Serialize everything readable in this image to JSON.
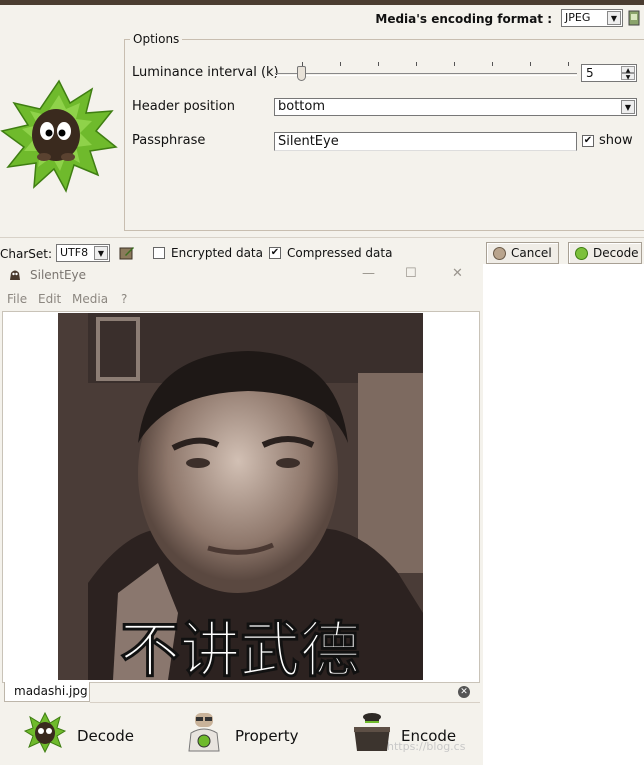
{
  "header": {
    "encoding_label": "Media's encoding format :",
    "encoding_value": "JPEG"
  },
  "options": {
    "title": "Options",
    "luminance_label": "Luminance interval (k)",
    "luminance_value": "5",
    "header_position_label": "Header position",
    "header_position_value": "bottom",
    "passphrase_label": "Passphrase",
    "passphrase_value": "SilentEye",
    "show_label": "show",
    "show_checked": true
  },
  "toolbar": {
    "charset_label": "CharSet:",
    "charset_value": "UTF8",
    "encrypted_label": "Encrypted data",
    "encrypted_checked": false,
    "compressed_label": "Compressed data",
    "compressed_checked": true,
    "cancel_label": "Cancel",
    "decode_label": "Decode"
  },
  "window": {
    "title": "SilentEye",
    "controls": [
      "—",
      "☐",
      "✕"
    ],
    "menu": [
      "File",
      "Edit",
      "Media",
      "?"
    ],
    "image_caption": "不讲武德",
    "tab_label": "madashi.jpg",
    "actions": [
      "Decode",
      "Property",
      "Encode"
    ],
    "watermark": "https://blog.cs"
  },
  "colors": {
    "accent_green": "#6fba2c",
    "dark_brown": "#4b3d31",
    "photo_tone": "#6e5d52"
  }
}
